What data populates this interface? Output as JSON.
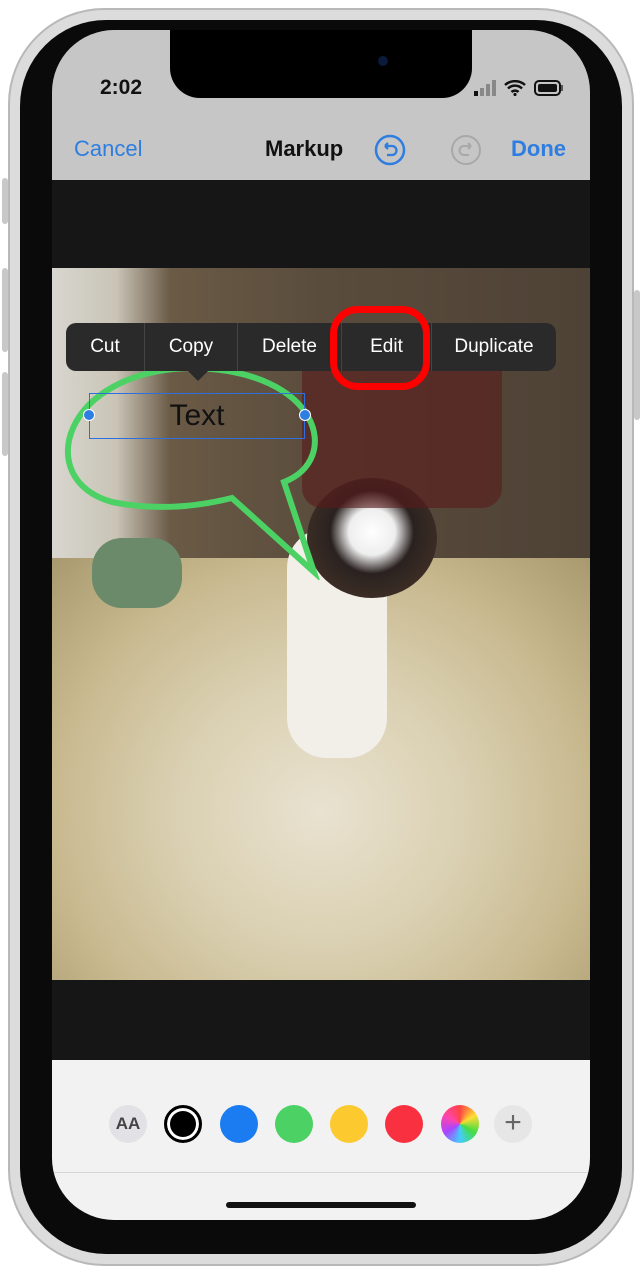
{
  "status": {
    "time": "2:02"
  },
  "nav": {
    "cancel": "Cancel",
    "title": "Markup",
    "done": "Done"
  },
  "canvas": {
    "text_annotation": "Text"
  },
  "context_menu": {
    "items": [
      "Cut",
      "Copy",
      "Delete",
      "Edit",
      "Duplicate"
    ],
    "highlighted": "Edit"
  },
  "toolbar": {
    "font_button": "AA",
    "colors": [
      "#000000",
      "#1a7cf0",
      "#4cd164",
      "#fcc92e",
      "#f9303f"
    ],
    "selected_color": "#000000",
    "add_label": "+"
  }
}
